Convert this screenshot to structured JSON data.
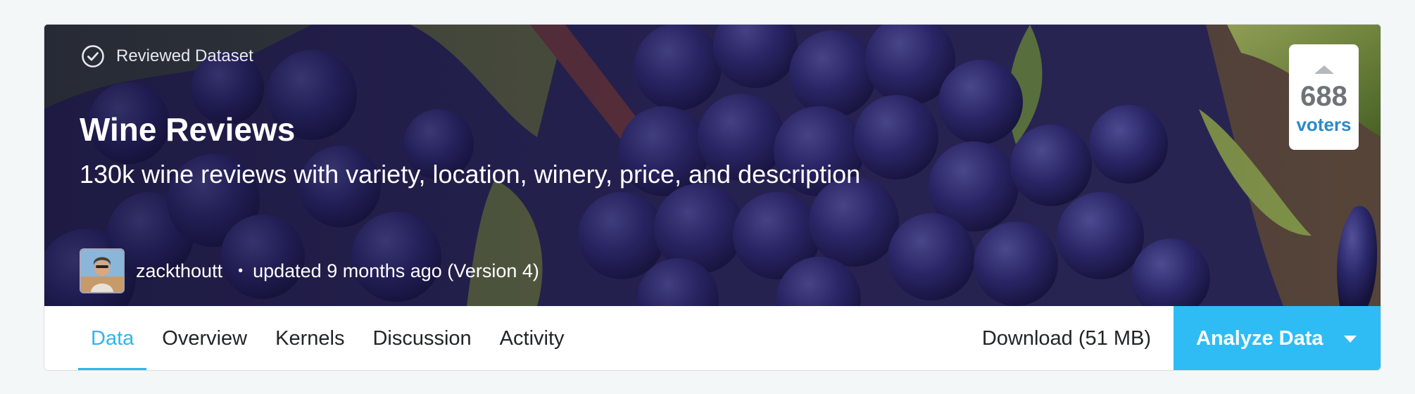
{
  "hero": {
    "badge": "Reviewed Dataset",
    "title": "Wine Reviews",
    "subtitle": "130k wine reviews with variety, location, winery, price, and description",
    "owner_name": "zackthoutt",
    "separator": "•",
    "updated": "updated 9 months ago (Version 4)",
    "icons": {
      "badge": "check-circle-icon",
      "vote": "upvote-arrow-icon"
    }
  },
  "vote": {
    "count": "688",
    "label": "voters"
  },
  "nav": {
    "tabs": [
      {
        "label": "Data",
        "active": true
      },
      {
        "label": "Overview",
        "active": false
      },
      {
        "label": "Kernels",
        "active": false
      },
      {
        "label": "Discussion",
        "active": false
      },
      {
        "label": "Activity",
        "active": false
      }
    ],
    "download": "Download (51 MB)",
    "analyze": "Analyze Data"
  },
  "colors": {
    "accent": "#2fbcf5",
    "active_tab": "#2fb4f0",
    "voters": "#2a8ac7",
    "page_bg": "#f4f7f8"
  }
}
